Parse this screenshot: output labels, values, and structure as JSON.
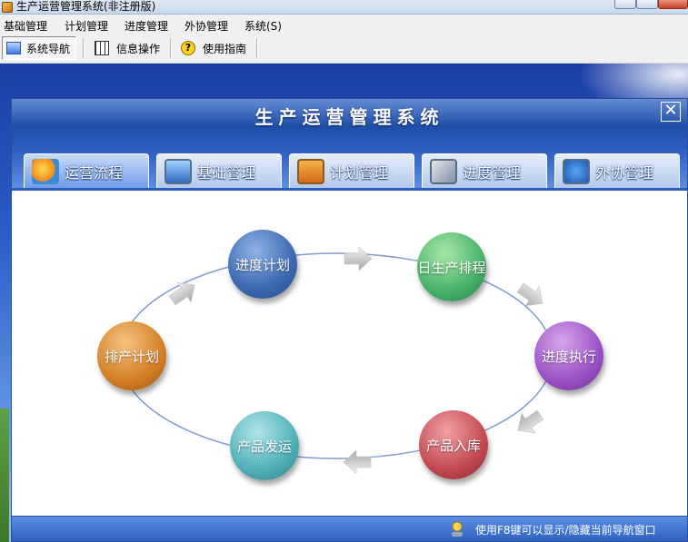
{
  "window": {
    "title": "生产运营管理系统(非注册版)"
  },
  "menu": [
    "基础管理",
    "计划管理",
    "进度管理",
    "外协管理",
    "系统(S)"
  ],
  "toolbar": {
    "nav": "系统导航",
    "info": "信息操作",
    "guide": "使用指南"
  },
  "nav_window": {
    "title": "生产运营管理系统",
    "close_glyph": "✕"
  },
  "tabs": [
    {
      "label": "运营流程",
      "active": true
    },
    {
      "label": "基础管理",
      "active": false
    },
    {
      "label": "计划管理",
      "active": false
    },
    {
      "label": "进度管理",
      "active": false
    },
    {
      "label": "外协管理",
      "active": false
    }
  ],
  "flow": {
    "nodes": [
      {
        "id": "plan-progress",
        "label": "进度计划",
        "color": "#3d68b0"
      },
      {
        "id": "daily-schedule",
        "label": "日生产排程",
        "color": "#47b26a"
      },
      {
        "id": "progress-exec",
        "label": "进度执行",
        "color": "#9a52c4"
      },
      {
        "id": "product-store",
        "label": "产品入库",
        "color": "#c34a52"
      },
      {
        "id": "product-ship",
        "label": "产品发运",
        "color": "#4fb0b8"
      },
      {
        "id": "production-plan",
        "label": "排产计划",
        "color": "#d37f25"
      }
    ]
  },
  "status": {
    "text": "使用F8键可以显示/隐藏当前导航窗口"
  }
}
